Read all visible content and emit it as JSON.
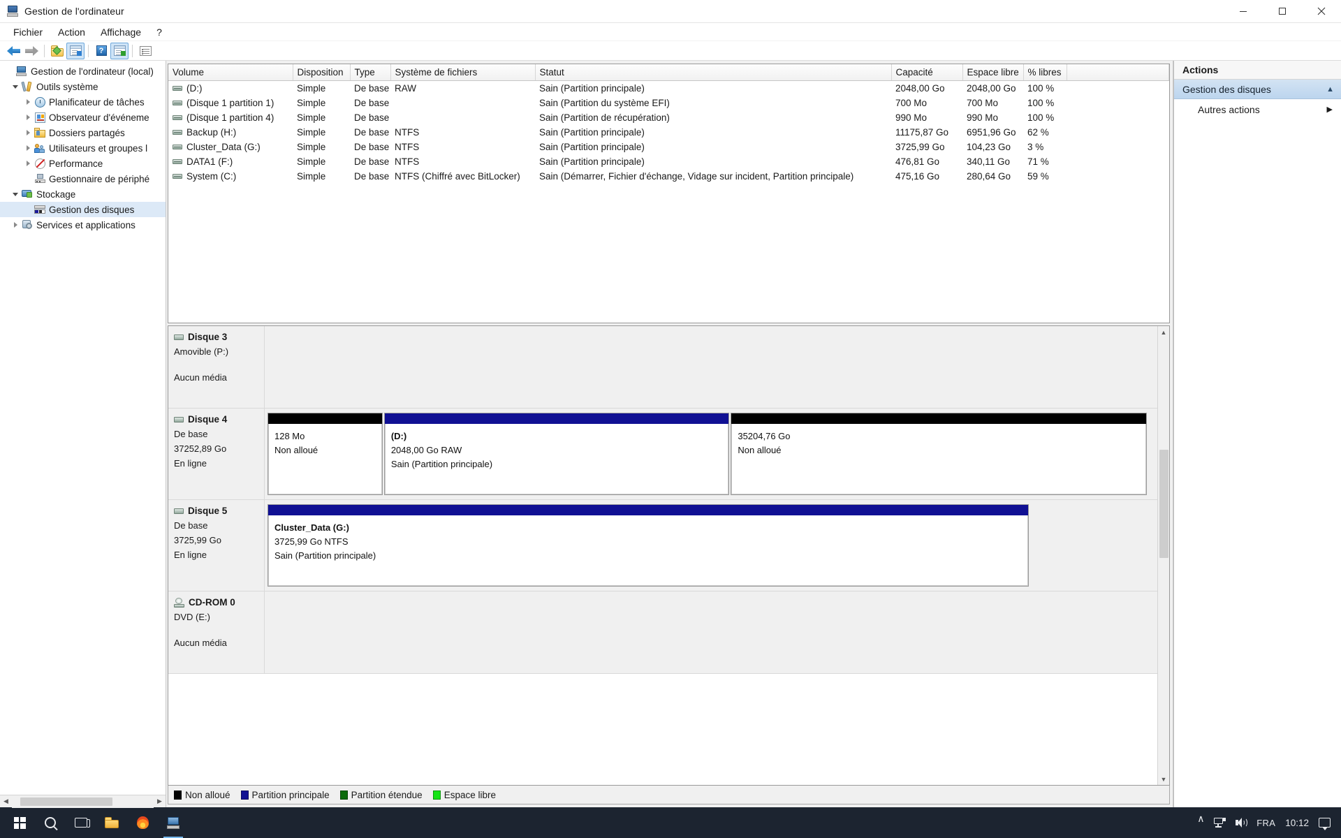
{
  "window": {
    "title": "Gestion de l'ordinateur",
    "icon": "computer-management-icon",
    "minimize": "minimize-button",
    "maximize": "maximize-button",
    "close": "close-button"
  },
  "menu": [
    "Fichier",
    "Action",
    "Affichage",
    "?"
  ],
  "toolbar": {
    "back": "back-arrow-icon",
    "forward": "forward-arrow-icon",
    "up": "up-folder-icon",
    "show_pane": "show-console-tree-icon",
    "help": "help-icon",
    "show_action": "show-action-pane-icon",
    "properties": "properties-list-icon"
  },
  "tree": {
    "root": "Gestion de l'ordinateur (local)",
    "items": [
      {
        "label": "Outils système",
        "level": 1,
        "expander": "open",
        "icon": "tools-icon"
      },
      {
        "label": "Planificateur de tâches",
        "level": 2,
        "expander": "closed",
        "icon": "clock-icon"
      },
      {
        "label": "Observateur d'événeme",
        "level": 2,
        "expander": "closed",
        "icon": "event-viewer-icon"
      },
      {
        "label": "Dossiers partagés",
        "level": 2,
        "expander": "closed",
        "icon": "shared-folders-icon"
      },
      {
        "label": "Utilisateurs et groupes l",
        "level": 2,
        "expander": "closed",
        "icon": "users-groups-icon"
      },
      {
        "label": "Performance",
        "level": 2,
        "expander": "closed",
        "icon": "performance-icon"
      },
      {
        "label": "Gestionnaire de périphé",
        "level": 2,
        "expander": "none",
        "icon": "device-manager-icon"
      },
      {
        "label": "Stockage",
        "level": 1,
        "expander": "open",
        "icon": "storage-icon"
      },
      {
        "label": "Gestion des disques",
        "level": 2,
        "expander": "none",
        "icon": "disk-management-icon",
        "selected": true
      },
      {
        "label": "Services et applications",
        "level": 1,
        "expander": "closed",
        "icon": "services-icon"
      }
    ]
  },
  "volumes": {
    "columns": [
      "Volume",
      "Disposition",
      "Type",
      "Système de fichiers",
      "Statut",
      "Capacité",
      "Espace libre",
      "% libres",
      ""
    ],
    "rows": [
      {
        "volume": "(D:)",
        "layout": "Simple",
        "type": "De base",
        "fs": "RAW",
        "status": "Sain (Partition principale)",
        "capacity": "2048,00 Go",
        "free": "2048,00 Go",
        "pct": "100 %"
      },
      {
        "volume": "(Disque 1 partition 1)",
        "layout": "Simple",
        "type": "De base",
        "fs": "",
        "status": "Sain (Partition du système EFI)",
        "capacity": "700 Mo",
        "free": "700 Mo",
        "pct": "100 %"
      },
      {
        "volume": "(Disque 1 partition 4)",
        "layout": "Simple",
        "type": "De base",
        "fs": "",
        "status": "Sain (Partition de récupération)",
        "capacity": "990 Mo",
        "free": "990 Mo",
        "pct": "100 %"
      },
      {
        "volume": "Backup (H:)",
        "layout": "Simple",
        "type": "De base",
        "fs": "NTFS",
        "status": "Sain (Partition principale)",
        "capacity": "11175,87 Go",
        "free": "6951,96 Go",
        "pct": "62 %"
      },
      {
        "volume": "Cluster_Data (G:)",
        "layout": "Simple",
        "type": "De base",
        "fs": "NTFS",
        "status": "Sain (Partition principale)",
        "capacity": "3725,99 Go",
        "free": "104,23 Go",
        "pct": "3 %"
      },
      {
        "volume": "DATA1 (F:)",
        "layout": "Simple",
        "type": "De base",
        "fs": "NTFS",
        "status": "Sain (Partition principale)",
        "capacity": "476,81 Go",
        "free": "340,11 Go",
        "pct": "71 %"
      },
      {
        "volume": "System (C:)",
        "layout": "Simple",
        "type": "De base",
        "fs": "NTFS (Chiffré avec BitLocker)",
        "status": "Sain (Démarrer, Fichier d'échange, Vidage sur incident, Partition principale)",
        "capacity": "475,16 Go",
        "free": "280,64 Go",
        "pct": "59 %"
      }
    ]
  },
  "disks": [
    {
      "name": "Disque 3",
      "icon": "removable-disk-icon",
      "line1": "Amovible (P:)",
      "line2": "",
      "line3": "Aucun média",
      "partitions": []
    },
    {
      "name": "Disque 4",
      "icon": "disk-icon",
      "line1": "De base",
      "line2": "37252,89 Go",
      "line3": "En ligne",
      "partitions": [
        {
          "title": "",
          "size": "128 Mo",
          "status": "Non alloué",
          "cap_color": "black",
          "width_pct": 13
        },
        {
          "title": "(D:)",
          "size": "2048,00 Go RAW",
          "status": "Sain (Partition principale)",
          "cap_color": "blue",
          "width_pct": 39
        },
        {
          "title": "",
          "size": "35204,76 Go",
          "status": "Non alloué",
          "cap_color": "black",
          "width_pct": 47
        }
      ]
    },
    {
      "name": "Disque 5",
      "icon": "disk-icon",
      "line1": "De base",
      "line2": "3725,99 Go",
      "line3": "En ligne",
      "partitions": [
        {
          "title": "Cluster_Data  (G:)",
          "size": "3725,99 Go NTFS",
          "status": "Sain (Partition principale)",
          "cap_color": "blue",
          "width_pct": 86
        }
      ]
    },
    {
      "name": "CD-ROM 0",
      "icon": "cdrom-icon",
      "line1": "DVD (E:)",
      "line2": "",
      "line3": "Aucun média",
      "partitions": []
    }
  ],
  "legend": [
    {
      "label": "Non alloué",
      "color": "#000000"
    },
    {
      "label": "Partition principale",
      "color": "#101093"
    },
    {
      "label": "Partition étendue",
      "color": "#0c6b0c"
    },
    {
      "label": "Espace libre",
      "color": "#16e416"
    }
  ],
  "actions": {
    "title": "Actions",
    "section": "Gestion des disques",
    "section_control": "collapse-chevron-up-icon",
    "item": "Autres actions",
    "item_control": "submenu-chevron-right-icon"
  },
  "taskbar": {
    "start": "windows-start-icon",
    "search": "search-icon",
    "taskview": "task-view-icon",
    "explorer": "file-explorer-icon",
    "firefox": "firefox-icon",
    "compmgmt": "computer-management-taskbar-icon",
    "tray_chevron": "show-hidden-icons-chevron",
    "network": "network-icon",
    "volume": "volume-icon",
    "language": "FRA",
    "clock": "10:12",
    "notifications": "notifications-icon"
  }
}
